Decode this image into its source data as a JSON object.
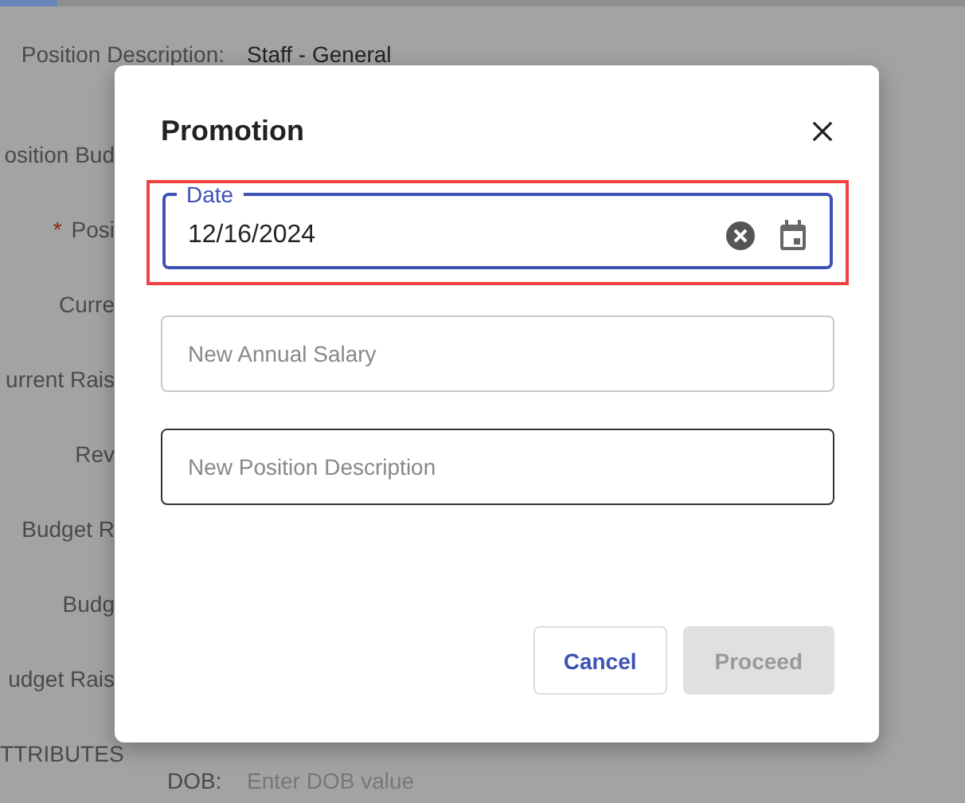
{
  "background_form": {
    "rows": [
      {
        "label": "Position Description:",
        "value": "Staff - General"
      },
      {
        "label": "osition Bud"
      },
      {
        "label": "Posi",
        "marker": "*"
      },
      {
        "label": "Curre"
      },
      {
        "label": "urrent Rais"
      },
      {
        "label": "Rev"
      },
      {
        "label": "Budget R"
      },
      {
        "label": "Budg"
      },
      {
        "label": "udget Rais"
      }
    ],
    "section_heading": "TTRIBUTES",
    "dob": {
      "label": "DOB:",
      "placeholder": "Enter DOB value"
    }
  },
  "dialog": {
    "title": "Promotion",
    "fields": [
      {
        "kind": "date",
        "label": "Date",
        "value": "12/16/2024",
        "focused": true,
        "highlighted": true,
        "hovered": false
      },
      {
        "kind": "text",
        "placeholder": "New Annual Salary",
        "focused": false,
        "highlighted": false,
        "hovered": false
      },
      {
        "kind": "text",
        "placeholder": "New Position Description",
        "focused": false,
        "highlighted": false,
        "hovered": true
      }
    ],
    "buttons": [
      {
        "kind": "secondary",
        "label": "Cancel",
        "disabled": false
      },
      {
        "kind": "primary",
        "label": "Proceed",
        "disabled": true
      }
    ]
  }
}
